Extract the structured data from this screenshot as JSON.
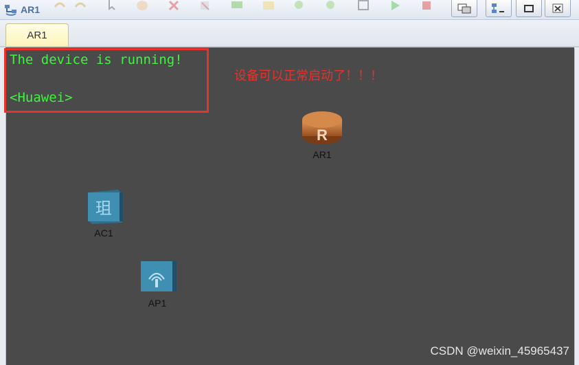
{
  "window": {
    "title": "AR1"
  },
  "tabs": [
    {
      "label": "AR1",
      "active": true
    }
  ],
  "console": {
    "line1": "The device is running!",
    "line2": "<Huawei>"
  },
  "annotation": "设备可以正常启动了！！！",
  "devices": [
    {
      "label": "AR1",
      "icon": "router-icon"
    },
    {
      "label": "AC1",
      "icon": "access-controller-icon"
    },
    {
      "label": "AP1",
      "icon": "access-point-icon"
    }
  ],
  "watermark": "CSDN @weixin_45965437",
  "colors": {
    "console_text": "#3ef53e",
    "highlight": "#e8322c",
    "canvas_bg": "#4a4a4a"
  }
}
